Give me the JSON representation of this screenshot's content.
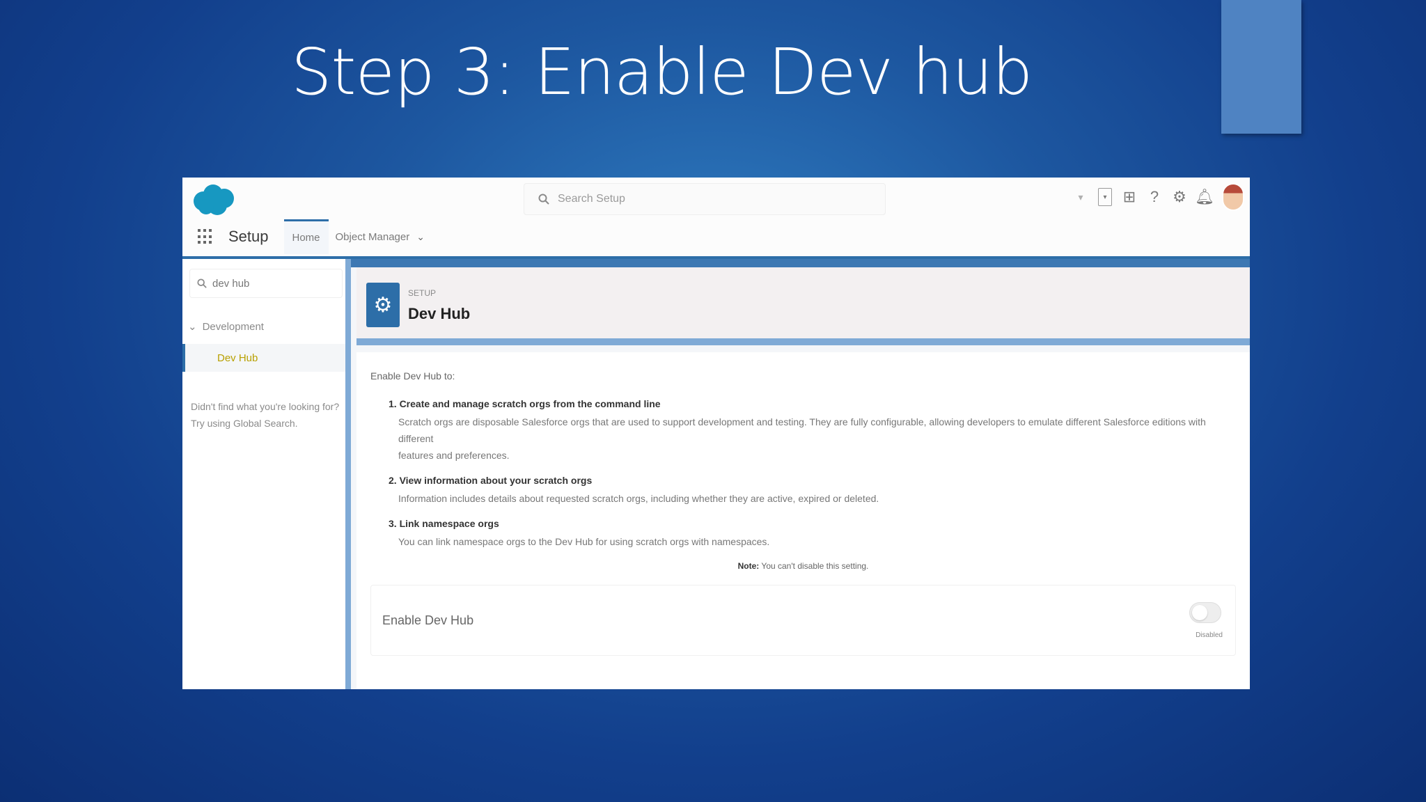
{
  "slide": {
    "title": "Step 3: Enable Dev hub"
  },
  "header": {
    "search_placeholder": "Search Setup",
    "app_name": "Setup",
    "tabs": [
      {
        "label": "Home"
      },
      {
        "label": "Object Manager"
      }
    ]
  },
  "left_panel": {
    "quick_find_value": "dev hub",
    "group_label": "Development",
    "item_label": "Dev Hub",
    "help_line1": "Didn't find what you're looking for?",
    "help_line2": "Try using Global Search."
  },
  "page": {
    "breadcrumb": "SETUP",
    "title": "Dev Hub",
    "intro": "Enable Dev Hub to:",
    "items": [
      {
        "heading": "1. Create and manage scratch orgs from the command line",
        "desc_line1": "Scratch orgs are disposable Salesforce orgs that are used to support development and testing. They are fully configurable, allowing developers to emulate different Salesforce editions with different",
        "desc_line2": "features and preferences."
      },
      {
        "heading": "2. View information about your scratch orgs",
        "desc_line1": "Information includes details about requested scratch orgs, including whether they are active, expired or deleted.",
        "desc_line2": ""
      },
      {
        "heading": "3. Link namespace orgs",
        "desc_line1": "You can link namespace orgs to the Dev Hub for using scratch orgs with namespaces.",
        "desc_line2": ""
      }
    ],
    "note_bold": "Note:",
    "note_text": "You can't disable this setting.",
    "enable_label": "Enable Dev Hub",
    "toggle_label": "Disabled"
  },
  "colors": {
    "salesforce_blue": "#1798c1",
    "accent": "#2d6ea8"
  }
}
